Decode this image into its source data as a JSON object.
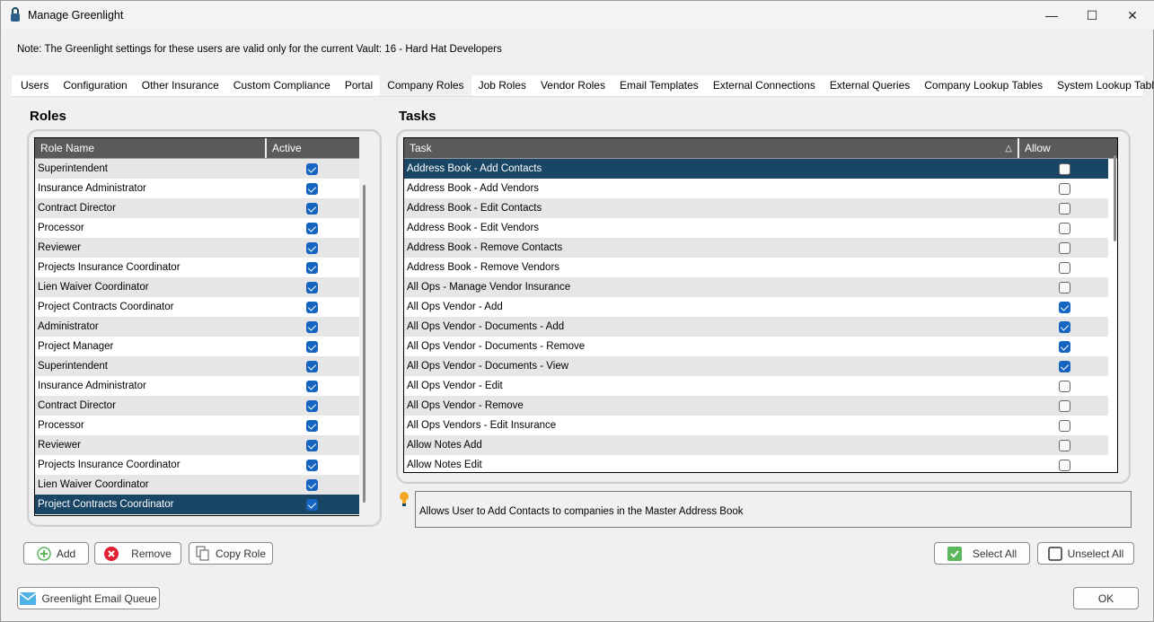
{
  "window": {
    "title": "Manage Greenlight",
    "minimize": "—",
    "maximize": "☐",
    "close": "✕"
  },
  "note": "Note:  The Greenlight settings for these users are valid only for the current Vault: 16 - Hard Hat Developers",
  "tabs": [
    "Users",
    "Configuration",
    "Other Insurance",
    "Custom Compliance",
    "Portal",
    "Company Roles",
    "Job Roles",
    "Vendor Roles",
    "Email Templates",
    "External Connections",
    "External Queries",
    "Company Lookup Tables",
    "System Lookup Tables"
  ],
  "active_tab": "Company Roles",
  "roles": {
    "heading": "Roles",
    "columns": [
      "Role Name",
      "Active"
    ],
    "rows": [
      {
        "name": "Superintendent",
        "active": true
      },
      {
        "name": "Insurance Administrator",
        "active": true
      },
      {
        "name": "Contract Director",
        "active": true
      },
      {
        "name": "Processor",
        "active": true
      },
      {
        "name": "Reviewer",
        "active": true
      },
      {
        "name": "Projects Insurance Coordinator",
        "active": true
      },
      {
        "name": "Lien Waiver Coordinator",
        "active": true
      },
      {
        "name": "Project Contracts Coordinator",
        "active": true
      },
      {
        "name": "Administrator",
        "active": true
      },
      {
        "name": "Project Manager",
        "active": true
      },
      {
        "name": "Superintendent",
        "active": true
      },
      {
        "name": "Insurance Administrator",
        "active": true
      },
      {
        "name": "Contract Director",
        "active": true
      },
      {
        "name": "Processor",
        "active": true
      },
      {
        "name": "Reviewer",
        "active": true
      },
      {
        "name": "Projects Insurance Coordinator",
        "active": true
      },
      {
        "name": "Lien Waiver Coordinator",
        "active": true
      },
      {
        "name": "Project Contracts Coordinator",
        "active": true,
        "selected": true
      }
    ]
  },
  "tasks": {
    "heading": "Tasks",
    "columns": [
      "Task",
      "Allow"
    ],
    "sort_icon": "sort-ascending-icon",
    "rows": [
      {
        "name": "Address Book - Add Contacts",
        "allow": false,
        "selected": true
      },
      {
        "name": "Address Book - Add Vendors",
        "allow": false
      },
      {
        "name": "Address Book - Edit Contacts",
        "allow": false
      },
      {
        "name": "Address Book - Edit Vendors",
        "allow": false
      },
      {
        "name": "Address Book - Remove Contacts",
        "allow": false
      },
      {
        "name": "Address Book - Remove Vendors",
        "allow": false
      },
      {
        "name": "All Ops - Manage Vendor Insurance",
        "allow": false
      },
      {
        "name": "All Ops Vendor - Add",
        "allow": true
      },
      {
        "name": "All Ops Vendor - Documents - Add",
        "allow": true
      },
      {
        "name": "All Ops Vendor - Documents - Remove",
        "allow": true
      },
      {
        "name": "All Ops Vendor - Documents - View",
        "allow": true
      },
      {
        "name": "All Ops Vendor - Edit",
        "allow": false
      },
      {
        "name": "All Ops Vendor - Remove",
        "allow": false
      },
      {
        "name": "All Ops Vendors - Edit Insurance",
        "allow": false
      },
      {
        "name": "Allow Notes Add",
        "allow": false
      },
      {
        "name": "Allow Notes Edit",
        "allow": false
      }
    ]
  },
  "info": "Allows User to Add Contacts to companies in the Master Address Book",
  "buttons": {
    "add": "Add",
    "remove": "Remove",
    "copy_role": "Copy Role",
    "select_all": "Select All",
    "unselect_all": "Unselect All",
    "email_queue": "Greenlight Email Queue",
    "ok": "OK"
  },
  "colors": {
    "selected_row": "#1a4666",
    "header": "#5a5a5a",
    "checkbox": "#1565c0"
  }
}
